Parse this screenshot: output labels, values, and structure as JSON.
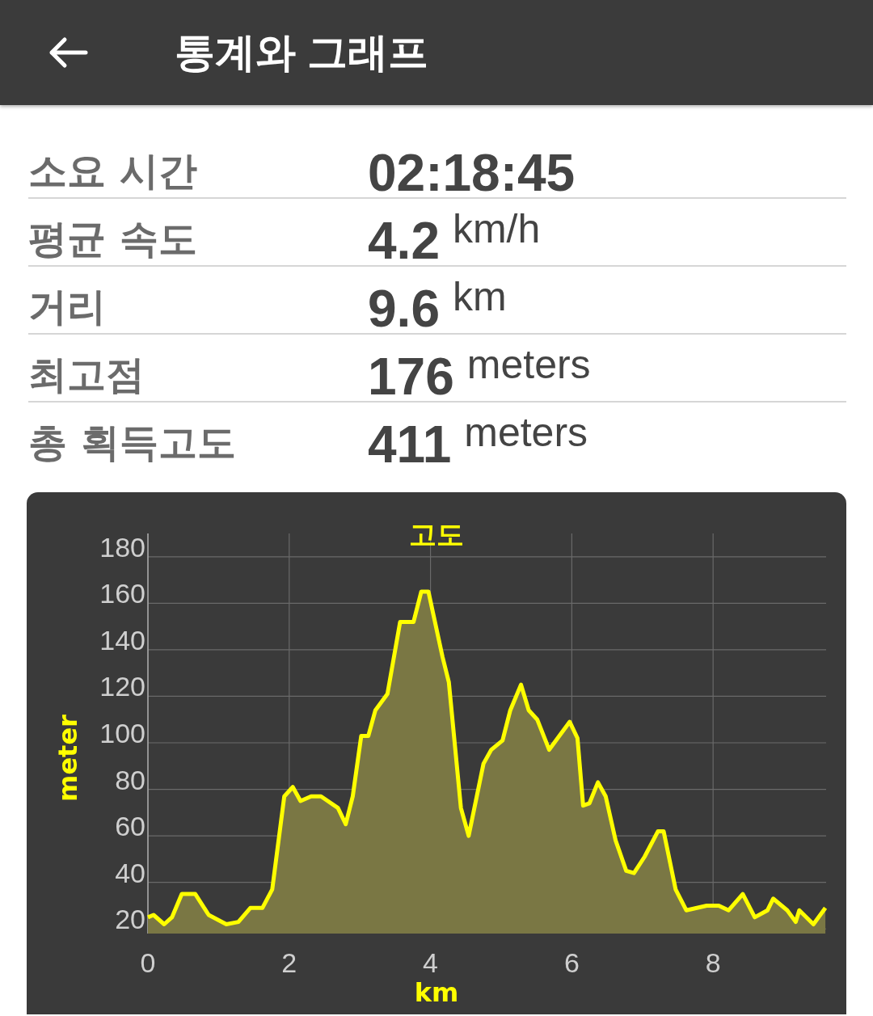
{
  "header": {
    "title": "통계와 그래프"
  },
  "stats": [
    {
      "label": "소요 시간",
      "value": "02:18:45"
    },
    {
      "label": "평균 속도",
      "value": "4.2",
      "unit": "km/h"
    },
    {
      "label": "거리",
      "value": "9.6",
      "unit": "km"
    },
    {
      "label": "최고점",
      "value": "176",
      "unit": "meters"
    },
    {
      "label": "총 획득고도",
      "value": "411",
      "unit": "meters"
    }
  ],
  "elevation_chart": {
    "chart_data": {
      "type": "area",
      "title": "고도",
      "xlabel": "km",
      "ylabel": "meter",
      "xlim": [
        0,
        9.6
      ],
      "ylim": [
        18,
        190
      ],
      "xticks": [
        0,
        2,
        4,
        6,
        8
      ],
      "yticks": [
        20,
        40,
        60,
        80,
        100,
        120,
        140,
        160,
        180
      ],
      "x": [
        0,
        0.08,
        0.23,
        0.34,
        0.48,
        0.67,
        0.86,
        1.11,
        1.28,
        1.45,
        1.62,
        1.76,
        1.93,
        2.05,
        2.16,
        2.31,
        2.45,
        2.69,
        2.8,
        2.9,
        3.02,
        3.12,
        3.22,
        3.39,
        3.57,
        3.76,
        3.87,
        3.97,
        4.17,
        4.26,
        4.43,
        4.54,
        4.75,
        4.86,
        5.02,
        5.13,
        5.28,
        5.39,
        5.51,
        5.68,
        5.97,
        6.08,
        6.16,
        6.25,
        6.37,
        6.48,
        6.62,
        6.77,
        6.88,
        7.03,
        7.22,
        7.3,
        7.47,
        7.62,
        7.91,
        8.08,
        8.22,
        8.42,
        8.59,
        8.77,
        8.85,
        9.05,
        9.17,
        9.22,
        9.42,
        9.59
      ],
      "grid": true,
      "series": [
        {
          "color": "#ffff00",
          "values": [
            25,
            26,
            22,
            25,
            35,
            35,
            26,
            22,
            23,
            29,
            29,
            37,
            77,
            81,
            75,
            77,
            77,
            72,
            65,
            77,
            103,
            103,
            114,
            121,
            152,
            152,
            165,
            165,
            137,
            126,
            72,
            60,
            91,
            97,
            101,
            114,
            125,
            114,
            110,
            97,
            109,
            102,
            73,
            74,
            83,
            77,
            58,
            45,
            44,
            51,
            62,
            62,
            37,
            28,
            30,
            30,
            28,
            35,
            25,
            28,
            33,
            28,
            23,
            28,
            22,
            29
          ]
        }
      ]
    }
  }
}
